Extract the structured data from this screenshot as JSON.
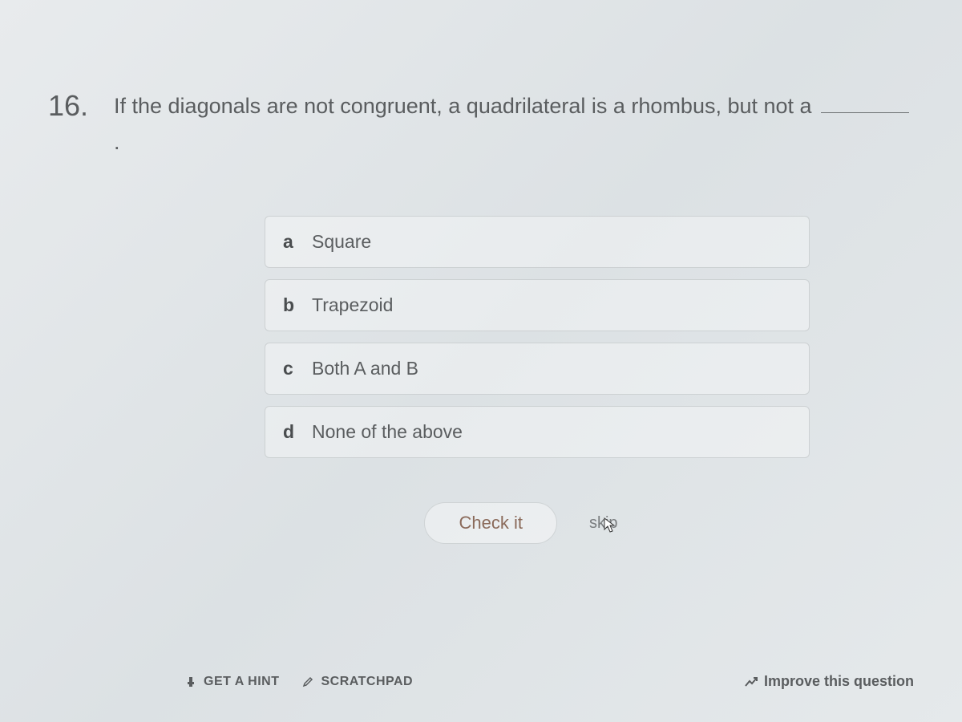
{
  "question": {
    "number": "16.",
    "text_before_blank": "If the diagonals are not congruent, a quadrilateral is a rhombus, but not a",
    "text_after_blank": "."
  },
  "choices": [
    {
      "letter": "a",
      "text": "Square"
    },
    {
      "letter": "b",
      "text": "Trapezoid"
    },
    {
      "letter": "c",
      "text": "Both A and B"
    },
    {
      "letter": "d",
      "text": "None of the above"
    }
  ],
  "actions": {
    "check_label": "Check it",
    "skip_label": "skip"
  },
  "bottom": {
    "hint_label": "GET A HINT",
    "scratch_label": "SCRATCHPAD",
    "improve_label": "Improve this question"
  }
}
